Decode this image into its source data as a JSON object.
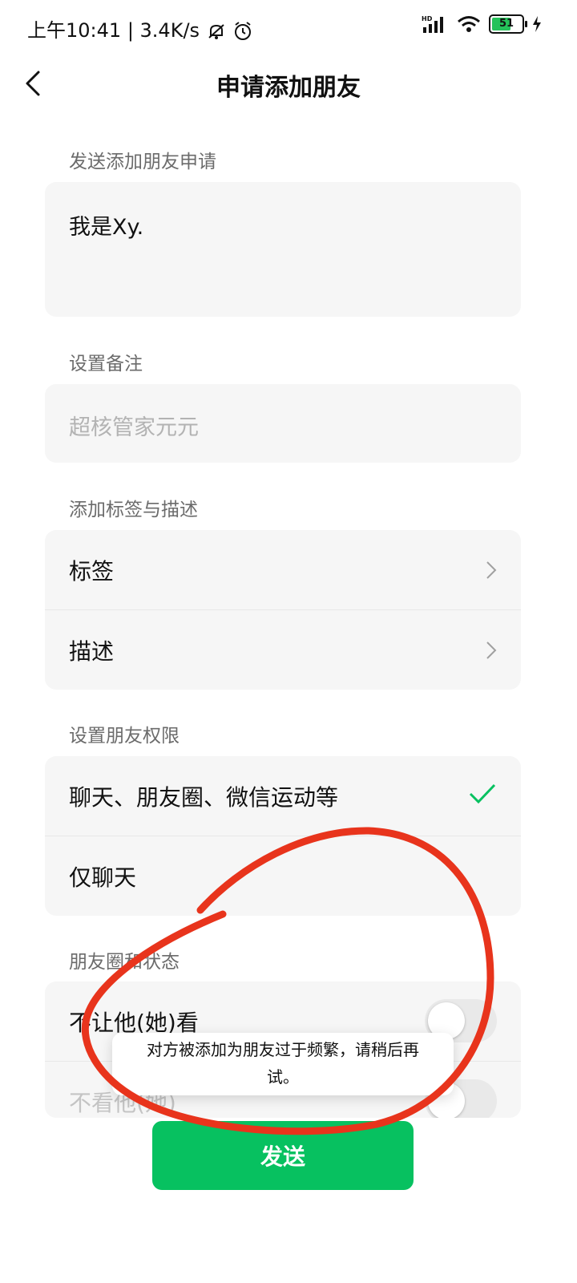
{
  "status_bar": {
    "time": "上午10:41",
    "net_speed": "3.4K/s",
    "battery": "51"
  },
  "header": {
    "title": "申请添加朋友"
  },
  "request": {
    "label": "发送添加朋友申请",
    "message": "我是Xy."
  },
  "remark": {
    "label": "设置备注",
    "placeholder": "超核管家元元"
  },
  "tags_desc": {
    "label": "添加标签与描述",
    "items": [
      {
        "label": "标签"
      },
      {
        "label": "描述"
      }
    ]
  },
  "permissions": {
    "label": "设置朋友权限",
    "options": [
      {
        "label": "聊天、朋友圈、微信运动等",
        "selected": true
      },
      {
        "label": "仅聊天",
        "selected": false
      }
    ]
  },
  "moments": {
    "label": "朋友圈和状态",
    "items": [
      {
        "label": "不让他(她)看",
        "on": false
      },
      {
        "label": "不看他(她)",
        "on": false
      }
    ]
  },
  "toast": {
    "message": "对方被添加为朋友过于频繁，请稍后再试。"
  },
  "send_button": {
    "label": "发送"
  },
  "colors": {
    "accent": "#07c160",
    "annotation": "#e8341c"
  }
}
